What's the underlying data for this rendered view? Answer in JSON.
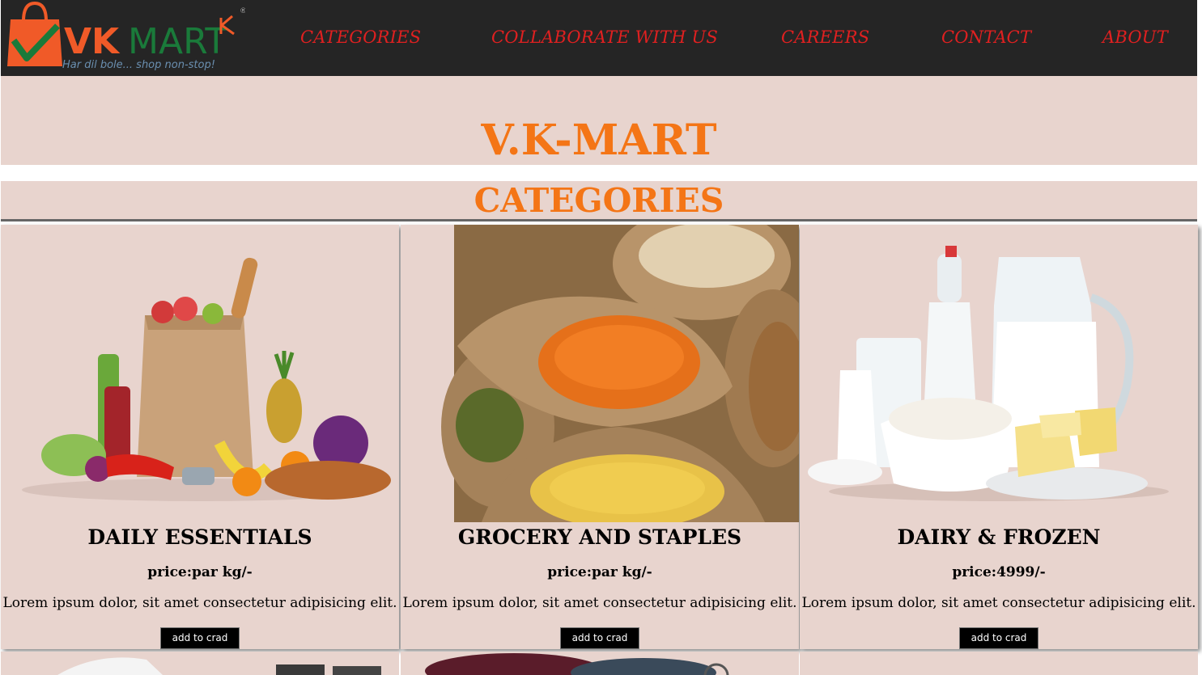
{
  "logo": {
    "brand_vk": "VK",
    "brand_mart": "MART",
    "tagline": "Har dil bole... shop non-stop!",
    "reg": "®"
  },
  "nav": {
    "items": [
      "CATEGORIES",
      "COLLABORATE WITH US",
      "CAREERS",
      "CONTACT",
      "ABOUT"
    ]
  },
  "hero": {
    "title": "V.K-MART"
  },
  "section": {
    "title": "CATEGORIES"
  },
  "cards": [
    {
      "title": "DAILY ESSENTIALS",
      "price": "price:par kg/-",
      "desc": "Lorem ipsum dolor, sit amet consectetur adipisicing elit.",
      "button": "add to crad",
      "image": "grocery-bag-image"
    },
    {
      "title": "GROCERY AND STAPLES",
      "price": "price:par kg/-",
      "desc": "Lorem ipsum dolor, sit amet consectetur adipisicing elit.",
      "button": "add to crad",
      "image": "grain-sacks-image"
    },
    {
      "title": "DAIRY & FROZEN",
      "price": "price:4999/-",
      "desc": "Lorem ipsum dolor, sit amet consectetur adipisicing elit.",
      "button": "add to crad",
      "image": "dairy-products-image"
    }
  ],
  "colors": {
    "nav_bg": "#252525",
    "nav_link": "#e02020",
    "accent": "#f47516",
    "card_bg": "#e8d4ce",
    "logo_green": "#1a7a3a"
  }
}
